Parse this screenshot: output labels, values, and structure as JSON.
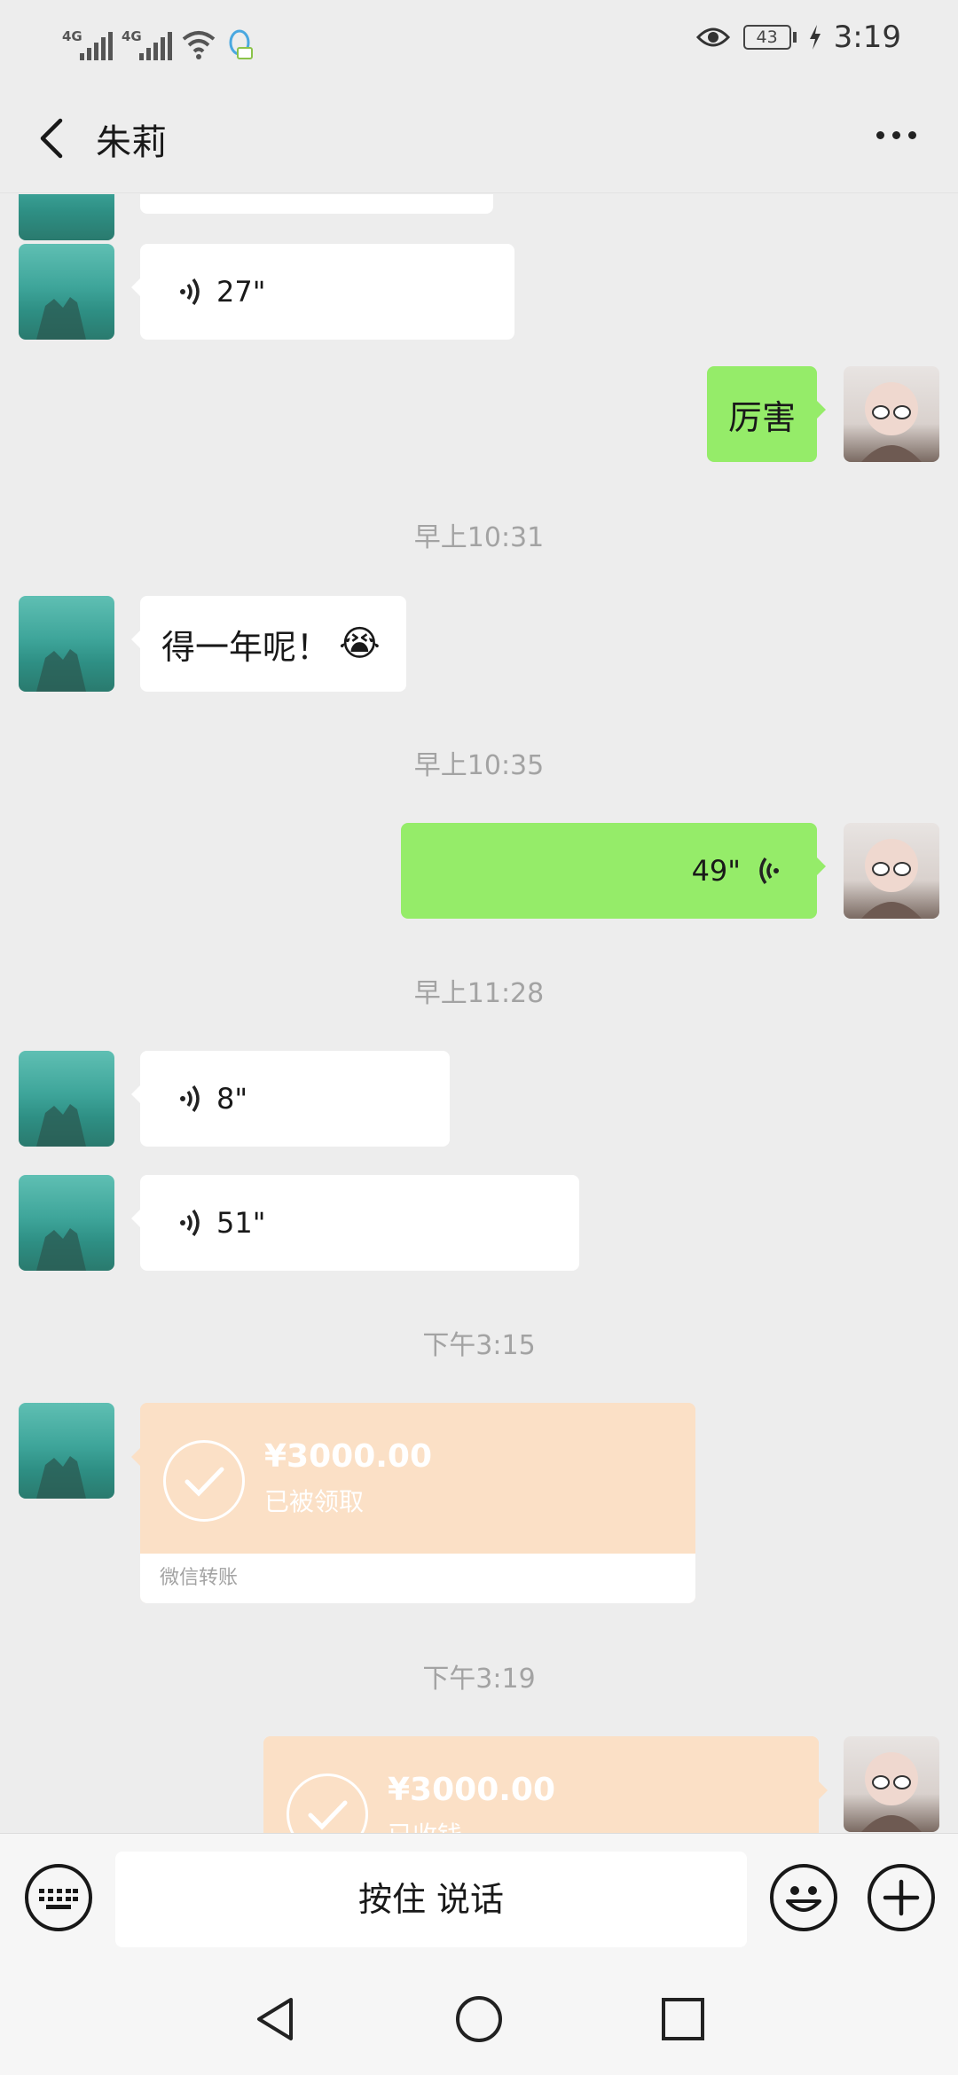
{
  "status_bar": {
    "network_1": "4G",
    "network_2": "4G",
    "battery": "43",
    "time": "3:19"
  },
  "header": {
    "title": "朱莉",
    "back_icon": "chevron-left-icon",
    "more_icon": "more-dots-icon"
  },
  "messages": [
    {
      "type": "voice",
      "from": "friend",
      "duration": "27\""
    },
    {
      "type": "text",
      "from": "me",
      "text": "厉害"
    },
    {
      "type": "timestamp",
      "text": "早上10:31"
    },
    {
      "type": "text",
      "from": "friend",
      "text": "得一年呢！",
      "emoji": "😭"
    },
    {
      "type": "timestamp",
      "text": "早上10:35"
    },
    {
      "type": "voice",
      "from": "me",
      "duration": "49\""
    },
    {
      "type": "timestamp",
      "text": "早上11:28"
    },
    {
      "type": "voice",
      "from": "friend",
      "duration": "8\""
    },
    {
      "type": "voice",
      "from": "friend",
      "duration": "51\""
    },
    {
      "type": "timestamp",
      "text": "下午3:15"
    },
    {
      "type": "transfer",
      "from": "friend",
      "amount": "¥3000.00",
      "status": "已被领取",
      "footer": "微信转账"
    },
    {
      "type": "timestamp",
      "text": "下午3:19"
    },
    {
      "type": "transfer",
      "from": "me",
      "amount": "¥3000.00",
      "status": "已收钱"
    }
  ],
  "input_bar": {
    "keyboard_icon": "keyboard-icon",
    "hold_to_talk": "按住 说话",
    "emoji_icon": "smiley-icon",
    "plus_icon": "plus-circle-icon"
  },
  "nav_bar": {
    "back_icon": "triangle-back-icon",
    "home_icon": "circle-home-icon",
    "recents_icon": "square-recents-icon"
  },
  "colors": {
    "background": "#ededed",
    "green_bubble": "#95ec69",
    "transfer_bg": "#fbe0c6",
    "timestamp": "#a3a3a3"
  }
}
